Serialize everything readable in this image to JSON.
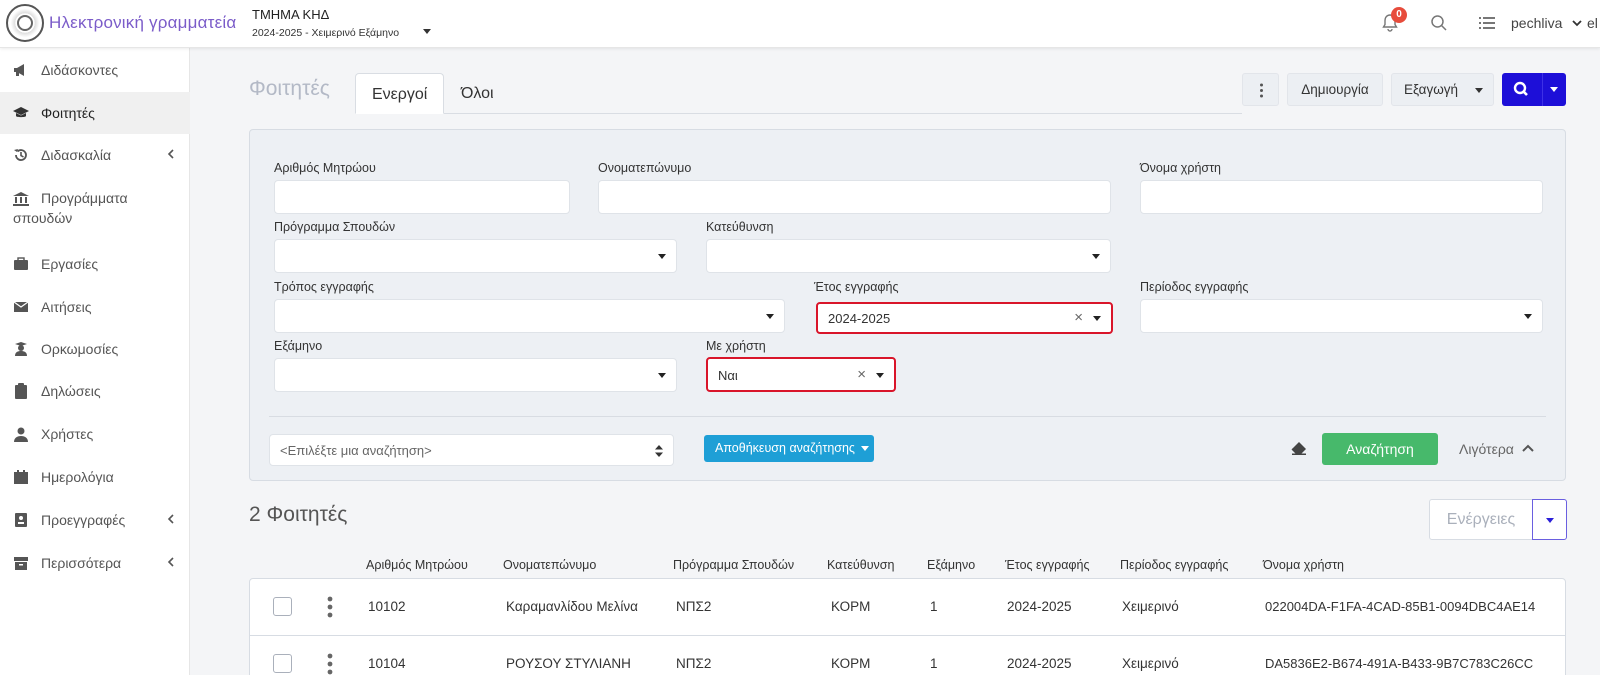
{
  "header": {
    "app_title": "Ηλεκτρονική γραμματεία",
    "department": "ΤΜΗΜΑ ΚΗΔ",
    "semester": "2024-2025 - Χειμερινό Εξάμηνο",
    "notifications_count": "0",
    "username": "pechliva",
    "language": "el"
  },
  "sidebar": {
    "items": [
      {
        "label": "Διδάσκοντες",
        "icon": "megaphone-icon"
      },
      {
        "label": "Φοιτητές",
        "icon": "graduation-cap-icon"
      },
      {
        "label": "Διδασκαλία",
        "icon": "history-icon"
      },
      {
        "label": "Προγράμματα σπουδών",
        "icon": "institution-icon"
      },
      {
        "label": "Εργασίες",
        "icon": "briefcase-icon"
      },
      {
        "label": "Αιτήσεις",
        "icon": "envelope-icon"
      },
      {
        "label": "Ορκωμοσίες",
        "icon": "graduate-icon"
      },
      {
        "label": "Δηλώσεις",
        "icon": "clipboard-icon"
      },
      {
        "label": "Χρήστες",
        "icon": "user-icon"
      },
      {
        "label": "Ημερολόγια",
        "icon": "calendar-icon"
      },
      {
        "label": "Προεγγραφές",
        "icon": "id-card-icon"
      },
      {
        "label": "Περισσότερα",
        "icon": "archive-icon"
      }
    ]
  },
  "page": {
    "title": "Φοιτητές",
    "tabs": [
      {
        "label": "Ενεργοί"
      },
      {
        "label": "Όλοι"
      }
    ],
    "create_label": "Δημιουργία",
    "export_label": "Εξαγωγή"
  },
  "filters": {
    "registry_number": {
      "label": "Αριθμός Μητρώου",
      "value": ""
    },
    "full_name": {
      "label": "Ονοματεπώνυμο",
      "value": ""
    },
    "username": {
      "label": "Όνομα χρήστη",
      "value": ""
    },
    "study_program": {
      "label": "Πρόγραμμα Σπουδών",
      "value": ""
    },
    "specialization": {
      "label": "Κατεύθυνση",
      "value": ""
    },
    "registration_method": {
      "label": "Τρόπος εγγραφής",
      "value": ""
    },
    "registration_year": {
      "label": "Έτος εγγραφής",
      "value": "2024-2025"
    },
    "registration_period": {
      "label": "Περίοδος εγγραφής",
      "value": ""
    },
    "semester": {
      "label": "Εξάμηνο",
      "value": ""
    },
    "has_user": {
      "label": "Με χρήστη",
      "value": "Ναι"
    },
    "saved_search_placeholder": "<Επιλέξτε μια αναζήτηση>",
    "save_search_label": "Αποθήκευση αναζήτησης",
    "search_label": "Αναζήτηση",
    "less_label": "Λιγότερα"
  },
  "results": {
    "count_label": "2 Φοιτητές",
    "actions_label": "Ενέργειες",
    "columns": [
      "Αριθμός Μητρώου",
      "Ονοματεπώνυμο",
      "Πρόγραμμα Σπουδών",
      "Κατεύθυνση",
      "Εξάμηνο",
      "Έτος εγγραφής",
      "Περίοδος εγγραφής",
      "Όνομα χρήστη"
    ],
    "rows": [
      [
        "10102",
        "Καραμανλίδου Μελίνα",
        "ΝΠΣ2",
        "ΚΟΡΜ",
        "1",
        "2024-2025",
        "Χειμερινό",
        "022004DA-F1FA-4CAD-85B1-0094DBC4AE14"
      ],
      [
        "10104",
        "ΡΟΥΣΟΥ ΣΤΥΛΙΑΝΗ",
        "ΝΠΣ2",
        "ΚΟΡΜ",
        "1",
        "2024-2025",
        "Χειμερινό",
        "DA5836E2-B674-491A-B433-9B7C783C26CC"
      ]
    ]
  },
  "colors": {
    "accent_purple": "#7b5cc9",
    "primary_blue": "#1d0fd8",
    "save_blue": "#1e9fd6",
    "search_green": "#47b96b",
    "highlight_red": "#d9152a"
  }
}
